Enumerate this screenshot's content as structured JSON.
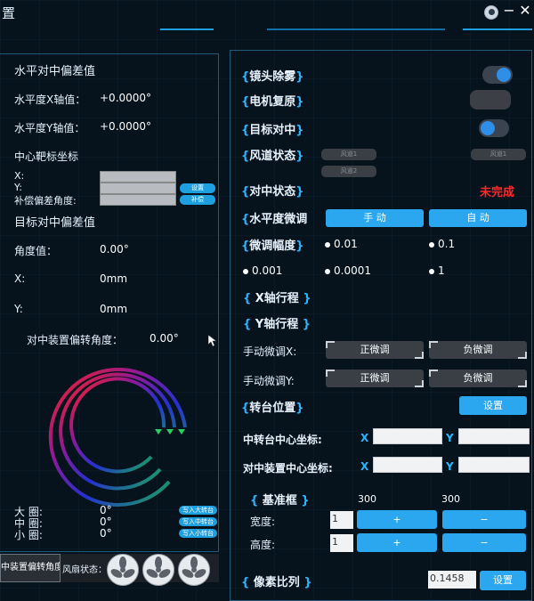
{
  "window": {
    "title": "置"
  },
  "left": {
    "section1_title": "水平对中偏差值",
    "hx_label": "水平度X轴值：",
    "hx_value": "+0.0000°",
    "hy_label": "水平度Y轴值：",
    "hy_value": "+0.0000°",
    "target_coord_title": "中心靶标坐标",
    "x_label": "X:",
    "y_label": "Y:",
    "comp_label": "补偿偏差角度:",
    "set_btn": "设置",
    "comp_btn": "补偿",
    "section2_title": "目标对中偏差值",
    "angle_label": "角度值：",
    "angle_value": "0.00°",
    "x2_label": "X:",
    "x2_value": "0mm",
    "y2_label": "Y:",
    "y2_value": "0mm",
    "rot_label": "对中装置偏转角度：",
    "rot_value": "0.00°",
    "big_label": "大 圈:",
    "big_value": "0°",
    "big_btn": "写入大转台",
    "mid_label": "中 圈:",
    "mid_value": "0°",
    "mid_btn": "写入中转台",
    "small_label": "小 圈:",
    "small_value": "0°",
    "small_btn": "写入小转台",
    "tab_label": "中装置偏转角度",
    "fan_label": "风扇状态："
  },
  "right": {
    "lens_title": "镜头除雾",
    "motor_title": "电机复原",
    "target_title": "目标对中",
    "duct_title": "风道状态",
    "duct_btn1": "风道1",
    "duct_btn2": "风道2",
    "duct_btn3": "风道1",
    "center_state_title": "对中状态",
    "center_state_value": "未完成",
    "level_fine_title": "水平度微调",
    "manual_btn": "手 动",
    "auto_btn": "自 动",
    "fine_range_title": "微调幅度",
    "opt1": "0.01",
    "opt2": "0.1",
    "opt3": "0.001",
    "opt4": "0.0001",
    "opt5": "1",
    "xtravel_title": "X轴行程",
    "ytravel_title": "Y轴行程",
    "manual_x_label": "手动微调X:",
    "manual_y_label": "手动微调Y:",
    "pos_btn": "正微调",
    "neg_btn": "负微调",
    "turntable_title": "转台位置",
    "set_label": "设置",
    "mid_center_label": "中转台中心坐标:",
    "dev_center_label": "对中装置中心坐标:",
    "x_axis": "X",
    "y_axis": "Y",
    "frame_title": "基准框",
    "frame_val1": "300",
    "frame_val2": "300",
    "width_label": "宽度:",
    "height_label": "高度:",
    "width_val": "1",
    "height_val": "1",
    "plus": "+",
    "minus": "−",
    "ratio_title": "像素比列",
    "ratio_val": "0.1458",
    "ratio_set": "设置"
  }
}
